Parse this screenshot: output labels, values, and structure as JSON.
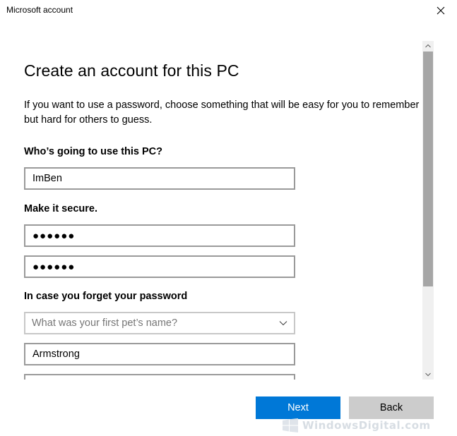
{
  "window": {
    "title": "Microsoft account",
    "close_glyph": "close-icon"
  },
  "page": {
    "title": "Create an account for this PC",
    "intro_line1": "If you want to use a password, choose something that will be easy for you to remember",
    "intro_line2": "but hard for others to guess."
  },
  "form": {
    "user_label": "Who’s going to use this PC?",
    "user_value": "ImBen",
    "secure_label": "Make it secure.",
    "password_value": "●●●●●●",
    "confirm_value": "●●●●●●",
    "recovery_label": "In case you forget your password",
    "question_placeholder": "What was your first pet’s name?",
    "answer_value": "Armstrong",
    "next_field_value": ""
  },
  "buttons": {
    "next_label": "Next",
    "back_label": "Back"
  },
  "watermark": {
    "text": "WindowsDigital.com"
  },
  "colors": {
    "accent": "#0078d7",
    "secondary_button": "#cccccc",
    "field_border": "#9a9a9a",
    "scroll_thumb": "#a6a6a6"
  }
}
